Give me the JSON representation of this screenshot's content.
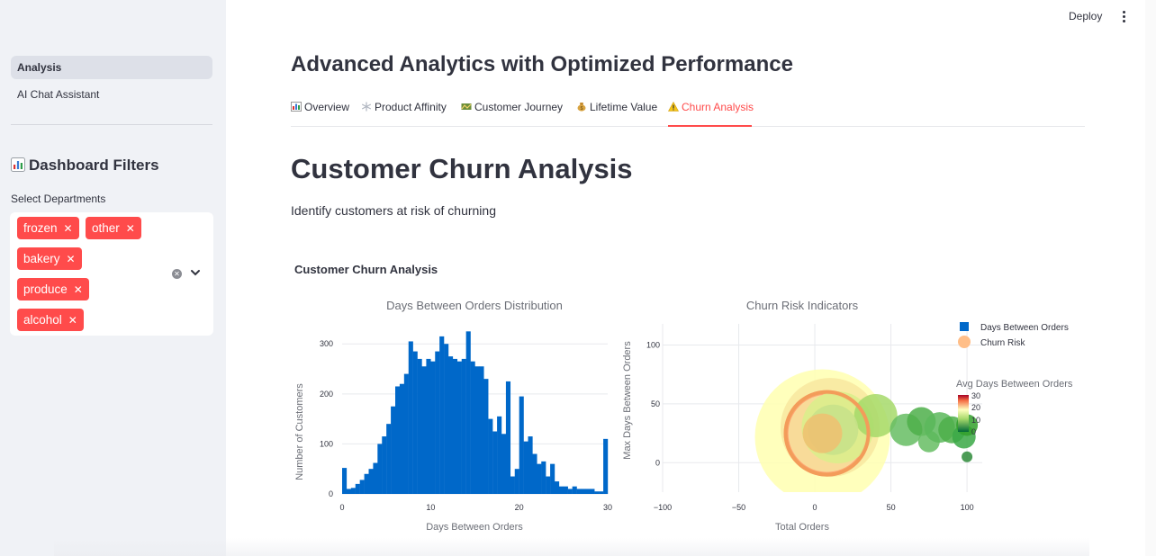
{
  "sidebar": {
    "nav": [
      {
        "label": "Analysis",
        "active": true
      },
      {
        "label": "AI Chat Assistant",
        "active": false
      }
    ],
    "filters_title": "Dashboard Filters",
    "filters_icon": "bar-chart-icon",
    "select_label": "Select Departments",
    "selected": [
      "frozen",
      "other",
      "bakery",
      "produce",
      "alcohol"
    ],
    "chip_color": "#ff4b4b"
  },
  "header": {
    "deploy_label": "Deploy"
  },
  "main": {
    "title": "Advanced Analytics with Optimized Performance",
    "tabs": [
      {
        "label": "Overview",
        "icon": "bar-chart-icon"
      },
      {
        "label": "Product Affinity",
        "icon": "snowflake-icon"
      },
      {
        "label": "Customer Journey",
        "icon": "map-icon"
      },
      {
        "label": "Lifetime Value",
        "icon": "money-bag-icon"
      },
      {
        "label": "Churn Analysis",
        "icon": "warning-icon",
        "active": true
      }
    ],
    "heading": "Customer Churn Analysis",
    "subtitle": "Identify customers at risk of churning",
    "figure_title": "Customer Churn Analysis"
  },
  "chart_data": [
    {
      "type": "bar",
      "title": "Days Between Orders Distribution",
      "xlabel": "Days Between Orders",
      "ylabel": "Number of Customers",
      "xlim": [
        0,
        30
      ],
      "ylim": [
        0,
        340
      ],
      "xticks": [
        "0",
        "10",
        "20",
        "30"
      ],
      "yticks": [
        "0",
        "100",
        "200",
        "300"
      ],
      "color": "#0068c9",
      "bin_width": 0.5,
      "x": [
        0,
        0.5,
        1,
        1.5,
        2,
        2.5,
        3,
        3.5,
        4,
        4.5,
        5,
        5.5,
        6,
        6.5,
        7,
        7.5,
        8,
        8.5,
        9,
        9.5,
        10,
        10.5,
        11,
        11.5,
        12,
        12.5,
        13,
        13.5,
        14,
        14.5,
        15,
        15.5,
        16,
        16.5,
        17,
        17.5,
        18,
        18.5,
        19,
        19.5,
        20,
        20.5,
        21,
        21.5,
        22,
        22.5,
        23,
        23.5,
        24,
        24.5,
        25,
        25.5,
        26,
        26.5,
        27,
        27.5,
        28,
        28.5,
        29,
        29.5
      ],
      "values": [
        52,
        10,
        12,
        20,
        28,
        40,
        50,
        62,
        100,
        115,
        140,
        175,
        215,
        220,
        240,
        305,
        285,
        270,
        255,
        270,
        265,
        285,
        315,
        300,
        275,
        270,
        265,
        270,
        325,
        265,
        255,
        255,
        230,
        150,
        125,
        155,
        120,
        225,
        35,
        50,
        195,
        105,
        115,
        80,
        60,
        65,
        35,
        60,
        25,
        15,
        15,
        10,
        15,
        10,
        10,
        10,
        10,
        5,
        5,
        110
      ]
    },
    {
      "type": "scatter",
      "title": "Churn Risk Indicators",
      "xlabel": "Total Orders",
      "ylabel": "Max Days Between Orders",
      "xlim": [
        -100,
        110
      ],
      "ylim": [
        -25,
        118
      ],
      "xticks": [
        "−100",
        "−50",
        "0",
        "50",
        "100"
      ],
      "yticks": [
        "0",
        "50",
        "100"
      ],
      "legend": [
        {
          "name": "Days Between Orders",
          "color": "#0068c9",
          "symbol": "square"
        },
        {
          "name": "Churn Risk",
          "color": "#ffbe88",
          "symbol": "circle"
        }
      ],
      "legend_position": "right",
      "colorbar": {
        "title": "Avg Days Between Orders",
        "ticks": [
          "0",
          "10",
          "20",
          "30"
        ],
        "colors": [
          "#006837",
          "#ffffbf",
          "#d73027",
          "#a50026"
        ]
      },
      "bubbles": [
        {
          "x": 5,
          "y": 22,
          "r": 75,
          "color": "#ffffb0"
        },
        {
          "x": 10,
          "y": 30,
          "r": 55,
          "color": "#f8e8a0"
        },
        {
          "x": 8,
          "y": 25,
          "r": 48,
          "color": "#ff9a6a"
        },
        {
          "x": 8,
          "y": 25,
          "r": 43,
          "color": "#f7e4a0"
        },
        {
          "x": 15,
          "y": 30,
          "r": 40,
          "color": "#d9ef8b"
        },
        {
          "x": 40,
          "y": 40,
          "r": 24,
          "color": "#a6d96a"
        },
        {
          "x": 60,
          "y": 28,
          "r": 18,
          "color": "#66bd63"
        },
        {
          "x": 70,
          "y": 35,
          "r": 16,
          "color": "#4daf4a"
        },
        {
          "x": 75,
          "y": 18,
          "r": 12,
          "color": "#66bd63"
        },
        {
          "x": 82,
          "y": 30,
          "r": 17,
          "color": "#5cb85c"
        },
        {
          "x": 90,
          "y": 28,
          "r": 15,
          "color": "#4daf4a"
        },
        {
          "x": 98,
          "y": 22,
          "r": 13,
          "color": "#39a845"
        },
        {
          "x": 100,
          "y": 32,
          "r": 12,
          "color": "#33a02c"
        },
        {
          "x": 100,
          "y": 5,
          "r": 6,
          "color": "#2e8b3a"
        },
        {
          "x": 12,
          "y": 28,
          "r": 28,
          "color": "#c7e28a"
        },
        {
          "x": 5,
          "y": 25,
          "r": 22,
          "color": "#f0c070"
        }
      ]
    }
  ]
}
